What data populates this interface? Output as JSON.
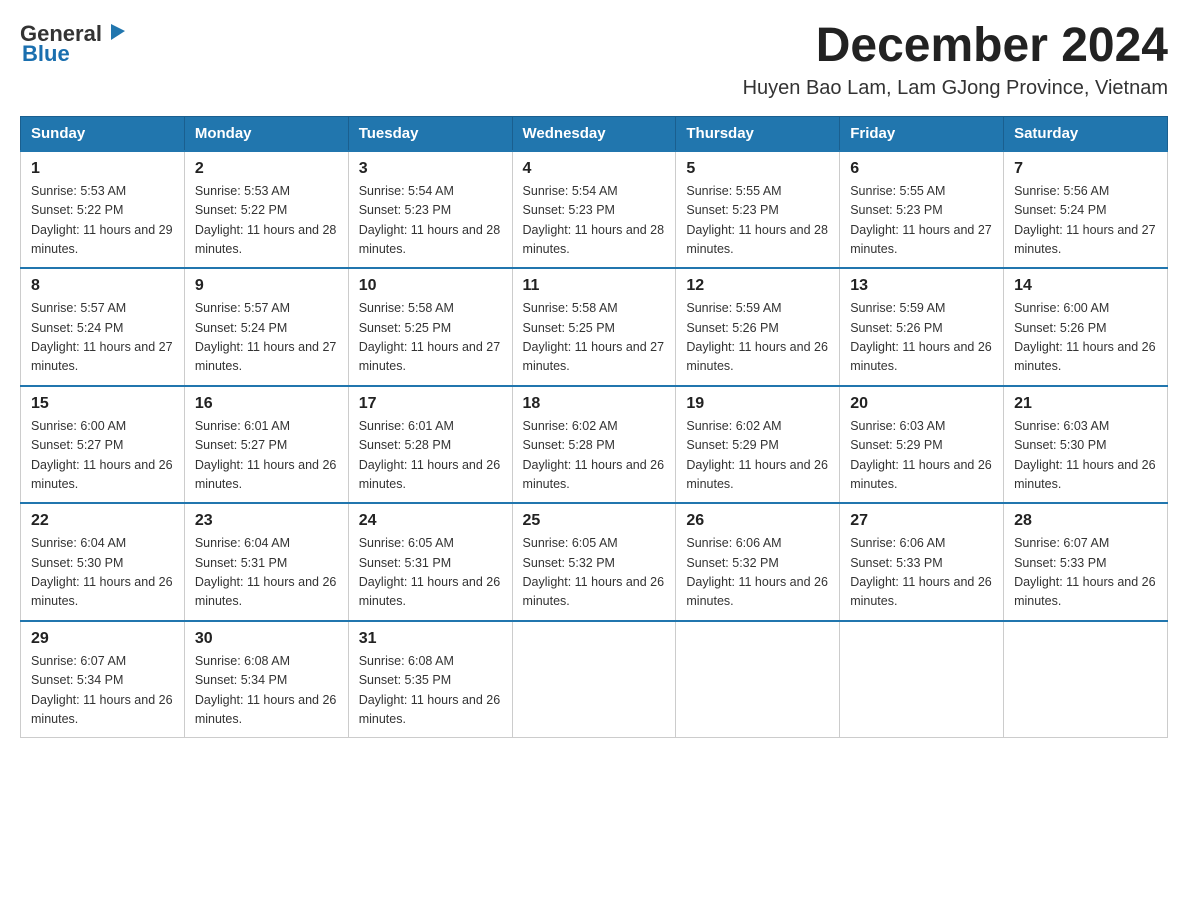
{
  "logo": {
    "text_general": "General",
    "text_blue": "Blue"
  },
  "header": {
    "month_title": "December 2024",
    "location": "Huyen Bao Lam, Lam GJong Province, Vietnam"
  },
  "weekdays": [
    "Sunday",
    "Monday",
    "Tuesday",
    "Wednesday",
    "Thursday",
    "Friday",
    "Saturday"
  ],
  "weeks": [
    [
      {
        "day": "1",
        "sunrise": "Sunrise: 5:53 AM",
        "sunset": "Sunset: 5:22 PM",
        "daylight": "Daylight: 11 hours and 29 minutes."
      },
      {
        "day": "2",
        "sunrise": "Sunrise: 5:53 AM",
        "sunset": "Sunset: 5:22 PM",
        "daylight": "Daylight: 11 hours and 28 minutes."
      },
      {
        "day": "3",
        "sunrise": "Sunrise: 5:54 AM",
        "sunset": "Sunset: 5:23 PM",
        "daylight": "Daylight: 11 hours and 28 minutes."
      },
      {
        "day": "4",
        "sunrise": "Sunrise: 5:54 AM",
        "sunset": "Sunset: 5:23 PM",
        "daylight": "Daylight: 11 hours and 28 minutes."
      },
      {
        "day": "5",
        "sunrise": "Sunrise: 5:55 AM",
        "sunset": "Sunset: 5:23 PM",
        "daylight": "Daylight: 11 hours and 28 minutes."
      },
      {
        "day": "6",
        "sunrise": "Sunrise: 5:55 AM",
        "sunset": "Sunset: 5:23 PM",
        "daylight": "Daylight: 11 hours and 27 minutes."
      },
      {
        "day": "7",
        "sunrise": "Sunrise: 5:56 AM",
        "sunset": "Sunset: 5:24 PM",
        "daylight": "Daylight: 11 hours and 27 minutes."
      }
    ],
    [
      {
        "day": "8",
        "sunrise": "Sunrise: 5:57 AM",
        "sunset": "Sunset: 5:24 PM",
        "daylight": "Daylight: 11 hours and 27 minutes."
      },
      {
        "day": "9",
        "sunrise": "Sunrise: 5:57 AM",
        "sunset": "Sunset: 5:24 PM",
        "daylight": "Daylight: 11 hours and 27 minutes."
      },
      {
        "day": "10",
        "sunrise": "Sunrise: 5:58 AM",
        "sunset": "Sunset: 5:25 PM",
        "daylight": "Daylight: 11 hours and 27 minutes."
      },
      {
        "day": "11",
        "sunrise": "Sunrise: 5:58 AM",
        "sunset": "Sunset: 5:25 PM",
        "daylight": "Daylight: 11 hours and 27 minutes."
      },
      {
        "day": "12",
        "sunrise": "Sunrise: 5:59 AM",
        "sunset": "Sunset: 5:26 PM",
        "daylight": "Daylight: 11 hours and 26 minutes."
      },
      {
        "day": "13",
        "sunrise": "Sunrise: 5:59 AM",
        "sunset": "Sunset: 5:26 PM",
        "daylight": "Daylight: 11 hours and 26 minutes."
      },
      {
        "day": "14",
        "sunrise": "Sunrise: 6:00 AM",
        "sunset": "Sunset: 5:26 PM",
        "daylight": "Daylight: 11 hours and 26 minutes."
      }
    ],
    [
      {
        "day": "15",
        "sunrise": "Sunrise: 6:00 AM",
        "sunset": "Sunset: 5:27 PM",
        "daylight": "Daylight: 11 hours and 26 minutes."
      },
      {
        "day": "16",
        "sunrise": "Sunrise: 6:01 AM",
        "sunset": "Sunset: 5:27 PM",
        "daylight": "Daylight: 11 hours and 26 minutes."
      },
      {
        "day": "17",
        "sunrise": "Sunrise: 6:01 AM",
        "sunset": "Sunset: 5:28 PM",
        "daylight": "Daylight: 11 hours and 26 minutes."
      },
      {
        "day": "18",
        "sunrise": "Sunrise: 6:02 AM",
        "sunset": "Sunset: 5:28 PM",
        "daylight": "Daylight: 11 hours and 26 minutes."
      },
      {
        "day": "19",
        "sunrise": "Sunrise: 6:02 AM",
        "sunset": "Sunset: 5:29 PM",
        "daylight": "Daylight: 11 hours and 26 minutes."
      },
      {
        "day": "20",
        "sunrise": "Sunrise: 6:03 AM",
        "sunset": "Sunset: 5:29 PM",
        "daylight": "Daylight: 11 hours and 26 minutes."
      },
      {
        "day": "21",
        "sunrise": "Sunrise: 6:03 AM",
        "sunset": "Sunset: 5:30 PM",
        "daylight": "Daylight: 11 hours and 26 minutes."
      }
    ],
    [
      {
        "day": "22",
        "sunrise": "Sunrise: 6:04 AM",
        "sunset": "Sunset: 5:30 PM",
        "daylight": "Daylight: 11 hours and 26 minutes."
      },
      {
        "day": "23",
        "sunrise": "Sunrise: 6:04 AM",
        "sunset": "Sunset: 5:31 PM",
        "daylight": "Daylight: 11 hours and 26 minutes."
      },
      {
        "day": "24",
        "sunrise": "Sunrise: 6:05 AM",
        "sunset": "Sunset: 5:31 PM",
        "daylight": "Daylight: 11 hours and 26 minutes."
      },
      {
        "day": "25",
        "sunrise": "Sunrise: 6:05 AM",
        "sunset": "Sunset: 5:32 PM",
        "daylight": "Daylight: 11 hours and 26 minutes."
      },
      {
        "day": "26",
        "sunrise": "Sunrise: 6:06 AM",
        "sunset": "Sunset: 5:32 PM",
        "daylight": "Daylight: 11 hours and 26 minutes."
      },
      {
        "day": "27",
        "sunrise": "Sunrise: 6:06 AM",
        "sunset": "Sunset: 5:33 PM",
        "daylight": "Daylight: 11 hours and 26 minutes."
      },
      {
        "day": "28",
        "sunrise": "Sunrise: 6:07 AM",
        "sunset": "Sunset: 5:33 PM",
        "daylight": "Daylight: 11 hours and 26 minutes."
      }
    ],
    [
      {
        "day": "29",
        "sunrise": "Sunrise: 6:07 AM",
        "sunset": "Sunset: 5:34 PM",
        "daylight": "Daylight: 11 hours and 26 minutes."
      },
      {
        "day": "30",
        "sunrise": "Sunrise: 6:08 AM",
        "sunset": "Sunset: 5:34 PM",
        "daylight": "Daylight: 11 hours and 26 minutes."
      },
      {
        "day": "31",
        "sunrise": "Sunrise: 6:08 AM",
        "sunset": "Sunset: 5:35 PM",
        "daylight": "Daylight: 11 hours and 26 minutes."
      },
      null,
      null,
      null,
      null
    ]
  ]
}
